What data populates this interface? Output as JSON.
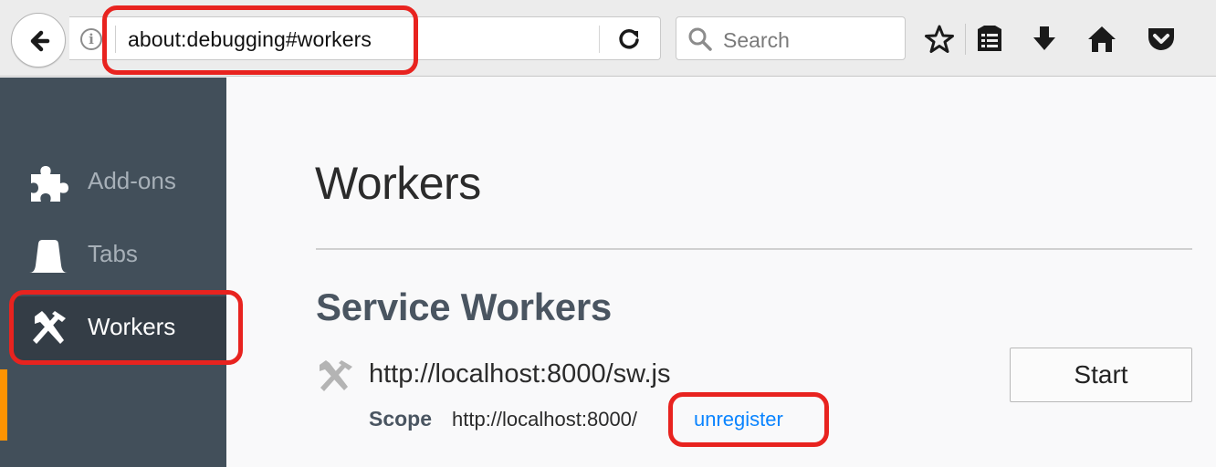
{
  "browser": {
    "url": "about:debugging#workers",
    "search_placeholder": "Search"
  },
  "sidebar": {
    "items": [
      {
        "label": "Add-ons",
        "icon": "puzzle-piece-icon",
        "selected": false
      },
      {
        "label": "Tabs",
        "icon": "tab-icon",
        "selected": false
      },
      {
        "label": "Workers",
        "icon": "hammer-pick-icon",
        "selected": true
      }
    ],
    "active_marker_color": "#ff9400"
  },
  "main": {
    "title": "Workers",
    "section_title": "Service Workers",
    "worker": {
      "name": "http://localhost:8000/sw.js",
      "scope_label": "Scope",
      "scope_value": "http://localhost:8000/",
      "unregister_label": "unregister",
      "start_label": "Start"
    }
  },
  "colors": {
    "sidebar_bg": "#424f5a",
    "highlight": "#e8231f",
    "link": "#0a84ff"
  }
}
